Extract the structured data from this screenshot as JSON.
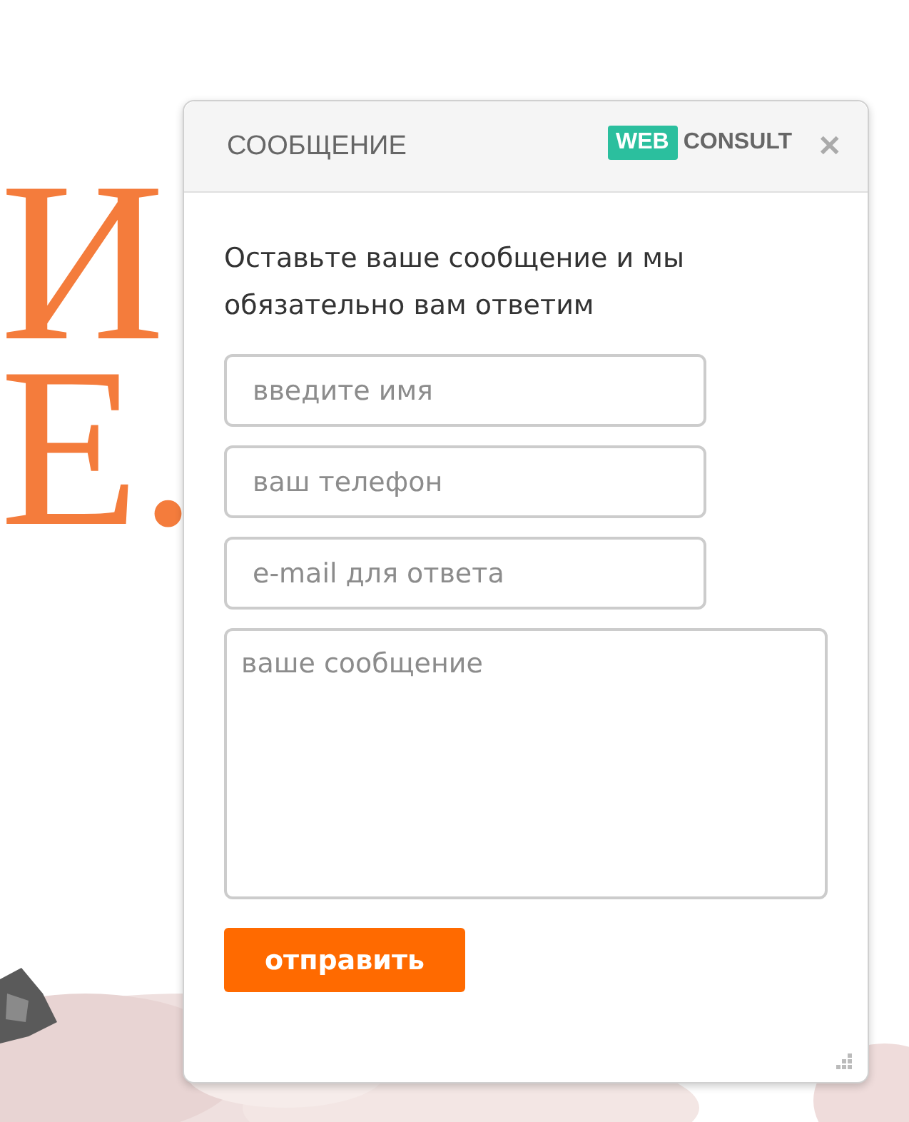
{
  "background_letters": [
    "И",
    "Е."
  ],
  "dialog": {
    "title": "СООБЩЕНИЕ",
    "logo": {
      "badge": "WEB",
      "word": "CONSULT"
    },
    "close": "✕",
    "intro": "Оставьте ваше сообщение и мы обязательно вам ответим",
    "fields": [
      {
        "kind": "input",
        "placeholder": "введите имя"
      },
      {
        "kind": "input",
        "placeholder": "ваш телефон"
      },
      {
        "kind": "input",
        "placeholder": "e-mail для ответа"
      },
      {
        "kind": "textarea",
        "placeholder": "ваше сообщение"
      }
    ],
    "submit": "отправить"
  }
}
